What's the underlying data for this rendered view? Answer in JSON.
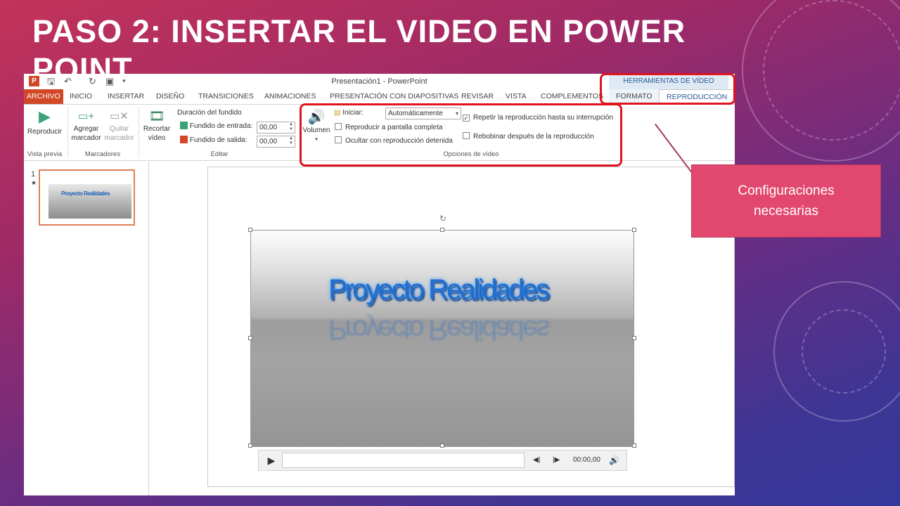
{
  "slide": {
    "title": "PASO 2: INSERTAR EL VIDEO EN POWER POINT",
    "callout": "Configuraciones necesarias"
  },
  "window": {
    "title": "Presentación1 - PowerPoint",
    "app_icon": "P",
    "context_header": "HERRAMIENTAS DE VÍDEO"
  },
  "tabs": {
    "archivo": "ARCHIVO",
    "inicio": "INICIO",
    "insertar": "INSERTAR",
    "diseno": "DISEÑO",
    "transiciones": "TRANSICIONES",
    "animaciones": "ANIMACIONES",
    "presentacion": "PRESENTACIÓN CON DIAPOSITIVAS",
    "revisar": "REVISAR",
    "vista": "VISTA",
    "complementos": "COMPLEMENTOS",
    "formato": "FORMATO",
    "reproduccion": "REPRODUCCIÓN"
  },
  "ribbon": {
    "reproducir": "Reproducir",
    "vista_previa": "Vista previa",
    "agregar_1": "Agregar",
    "agregar_2": "marcador",
    "quitar_1": "Quitar",
    "quitar_2": "marcador",
    "marcadores": "Marcadores",
    "recortar_1": "Recortar",
    "recortar_2": "vídeo",
    "duracion": "Duración del fundido",
    "fundido_entrada": "Fundido de entrada:",
    "fundido_entrada_val": "00,00",
    "fundido_salida": "Fundido de salida:",
    "fundido_salida_val": "00,00",
    "editar": "Editar",
    "volumen": "Volumen",
    "iniciar": "Iniciar:",
    "iniciar_val": "Automáticamente",
    "pantalla_completa": "Reproducir a pantalla completa",
    "ocultar": "Ocultar con reproducción detenida",
    "repetir": "Repetir la reproducción hasta su interrupción",
    "rebobinar": "Rebobinar después de la reproducción",
    "opciones": "Opciones de vídeo"
  },
  "thumbs": {
    "number": "1",
    "star": "★",
    "thumb_text": "Proyecto Realidades"
  },
  "video": {
    "logo": "Proyecto Realidades",
    "time": "00:00,00"
  },
  "colors": {
    "accent": "#d24726",
    "highlight": "#e0141e",
    "callout": "#e2476f"
  }
}
